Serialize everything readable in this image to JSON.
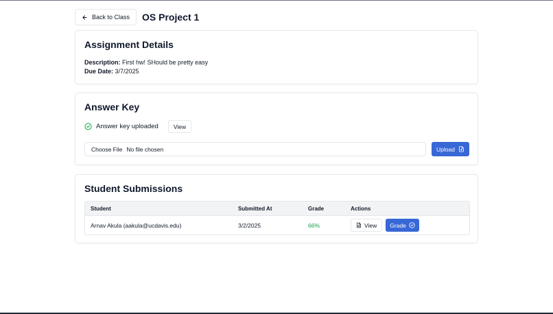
{
  "header": {
    "back_label": "Back to Class",
    "title": "OS Project 1"
  },
  "details": {
    "heading": "Assignment Details",
    "description_label": "Description:",
    "description_value": "First hw! SHould be pretty easy",
    "due_label": "Due Date:",
    "due_value": "3/7/2025"
  },
  "answer_key": {
    "heading": "Answer Key",
    "status": "Answer key uploaded",
    "view_label": "View",
    "choose_file_label": "Choose File",
    "no_file_text": "No file chosen",
    "upload_label": "Upload"
  },
  "submissions": {
    "heading": "Student Submissions",
    "columns": [
      "Student",
      "Submitted At",
      "Grade",
      "Actions"
    ],
    "rows": [
      {
        "student": "Arnav Akula (aakula@ucdavis.edu)",
        "submitted_at": "3/2/2025",
        "grade": "66%",
        "view_label": "View",
        "grade_label": "Grade"
      }
    ]
  },
  "colors": {
    "primary": "#3867d6",
    "success": "#16a34a",
    "border": "#e5e7eb",
    "table_header_bg": "#f1f3f5"
  }
}
